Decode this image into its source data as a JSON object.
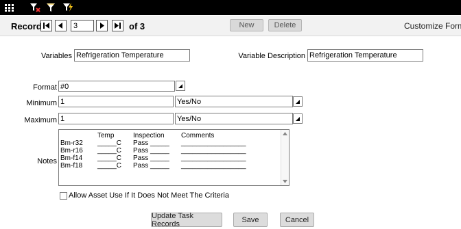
{
  "toolbar": {
    "icons": [
      "grid-icon",
      "funnel-x-icon",
      "funnel-icon",
      "funnel-lightning-icon"
    ]
  },
  "record_nav": {
    "label": "Record:",
    "current": "3",
    "of_text": "of 3",
    "new_label": "New",
    "delete_label": "Delete",
    "customize_label": "Customize Form"
  },
  "form": {
    "variables_label": "Variables",
    "variables_value": "Refrigeration Temperature",
    "variable_description_label": "Variable Description",
    "variable_description_value": "Refrigeration Temperature",
    "format_label": "Format",
    "format_value": "#0",
    "minimum_label": "Minimum",
    "minimum_value": "1",
    "minimum_type": "Yes/No",
    "maximum_label": "Maximum",
    "maximum_value": "1",
    "maximum_type": "Yes/No",
    "notes_label": "Notes",
    "notes": {
      "headers": [
        "Temp",
        "Inspection",
        "Comments"
      ],
      "rows": [
        [
          "Bm-r32",
          "_____C",
          "Pass _____",
          "_________________"
        ],
        [
          "Bm-r16",
          "_____C",
          "Pass _____",
          "_________________"
        ],
        [
          "Bm-f14",
          "_____C",
          "Pass _____",
          "_________________"
        ],
        [
          "Bm-f18",
          "_____C",
          "Pass _____",
          "_________________"
        ]
      ]
    },
    "allow_asset_label": "Allow Asset Use If It Does Not Meet The Criteria"
  },
  "buttons": {
    "update_label": "Update Task Records",
    "save_label": "Save",
    "cancel_label": "Cancel"
  }
}
